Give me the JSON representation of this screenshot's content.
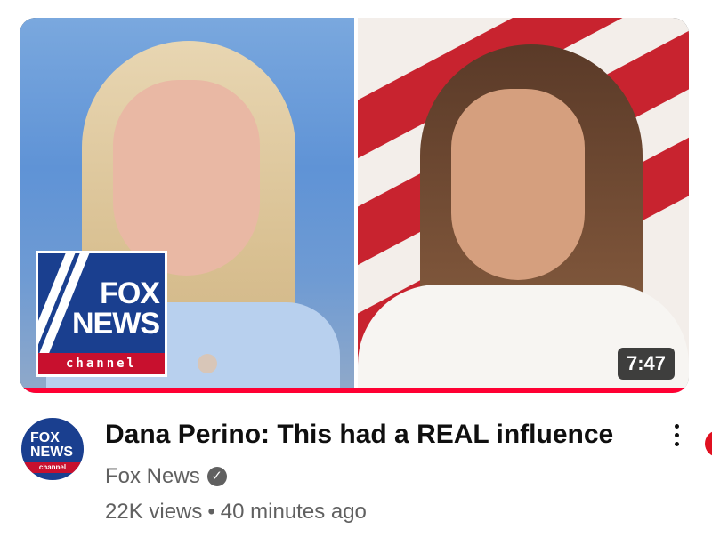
{
  "video": {
    "duration": "7:47",
    "watch_progress_percent": 100,
    "title": "Dana Perino: This had a REAL influence",
    "channel": {
      "name": "Fox News",
      "verified_icon": "check-circle-icon",
      "logo_top": "FOX",
      "logo_bottom": "NEWS",
      "logo_channel": "channel"
    },
    "views": "22K views",
    "separator": "•",
    "age": "40 minutes ago"
  },
  "colors": {
    "progress": "#ff0033",
    "fox_blue": "#1a3f8f",
    "fox_red": "#c8102e",
    "secondary_text": "#606060",
    "primary_text": "#0f0f0f"
  },
  "icons": {
    "more": "more-vert-icon"
  }
}
